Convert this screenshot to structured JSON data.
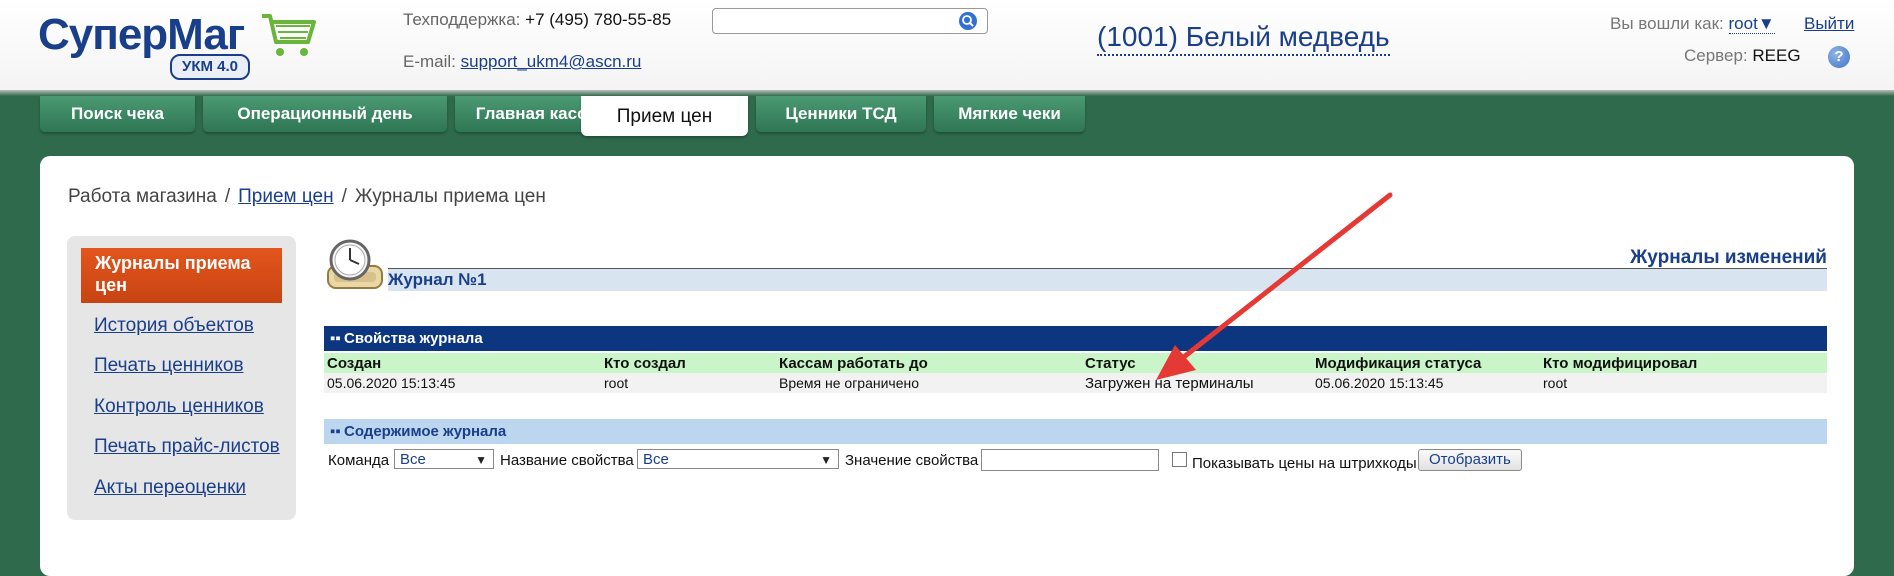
{
  "logo": {
    "part1": "Супер",
    "part2": "Маг",
    "badge": "УКМ 4.0"
  },
  "header": {
    "support_label": "Техподдержка:",
    "support_phone": "+7 (495) 780-55-85",
    "email_label": "E-mail:",
    "email": "support_ukm4@ascn.ru",
    "search_placeholder": "",
    "store": "(1001) Белый медведь",
    "login_label": "Вы вошли как:",
    "user": "root",
    "logout": "Выйти",
    "server_label": "Сервер:",
    "server": "REEG",
    "help": "?"
  },
  "tabs": [
    {
      "label": "Поиск чека"
    },
    {
      "label": "Операционный день"
    },
    {
      "label": "Главная касса"
    },
    {
      "label": "Прием цен"
    },
    {
      "label": "Ценники ТСД"
    },
    {
      "label": "Мягкие чеки"
    }
  ],
  "breadcrumb": {
    "root": "Работа магазина",
    "link": "Прием цен",
    "current": "Журналы приема цен"
  },
  "sidebar": {
    "active": "Журналы приема цен",
    "links": [
      "История объектов",
      "Печать ценников",
      "Контроль ценников",
      "Печать прайс-листов",
      "Акты переоценки"
    ]
  },
  "content": {
    "changes_title": "Журналы изменений",
    "journal_title": "Журнал №1",
    "props_title": "Свойства журнала",
    "columns": [
      "Создан",
      "Кто создал",
      "Кассам работать до",
      "Статус",
      "Модификация статуса",
      "Кто модифицировал"
    ],
    "row": [
      "05.06.2020 15:13:45",
      "root",
      "Время не ограничено",
      "Загружен на терминалы",
      "05.06.2020 15:13:45",
      "root"
    ],
    "contents_title": "Содержимое журнала",
    "filters": {
      "command_label": "Команда",
      "command_value": "Все",
      "prop_name_label": "Название свойства",
      "prop_name_value": "Все",
      "prop_value_label": "Значение свойства",
      "show_prices_label": "Показывать цены на штрихкоды",
      "show_button": "Отобразить"
    }
  },
  "colors": {
    "brand": "#1a3f8a",
    "background": "#2e6a4b",
    "accent": "#e3551c",
    "arrow": "#e53935"
  }
}
